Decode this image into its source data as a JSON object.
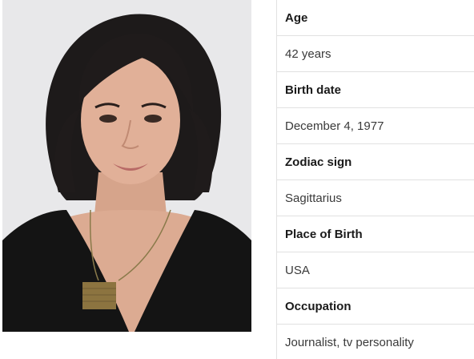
{
  "profile": {
    "photo": {
      "icon": "portrait-photo"
    },
    "facts": [
      {
        "label": "Age",
        "value": "42 years"
      },
      {
        "label": "Birth date",
        "value": "December 4, 1977"
      },
      {
        "label": "Zodiac sign",
        "value": "Sagittarius"
      },
      {
        "label": "Place of Birth",
        "value": "USA"
      },
      {
        "label": "Occupation",
        "value": "Journalist, tv personality"
      }
    ]
  }
}
